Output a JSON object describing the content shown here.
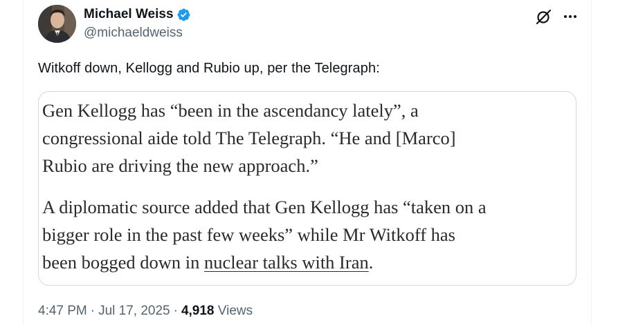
{
  "author": {
    "display_name": "Michael Weiss",
    "handle": "@michaeldweiss",
    "verified": true,
    "verified_color": "#1d9bf0"
  },
  "tweet": {
    "text": "Witkoff down, Kellogg and Rubio up, per the Telegraph:"
  },
  "quote_image": {
    "paragraph1_lines": [
      "Gen Kellogg has “been in the ascendancy lately”, a",
      "congressional aide told The Telegraph. “He and [Marco]",
      "Rubio are driving the new approach.”"
    ],
    "paragraph2_lines": [
      "A diplomatic source added that Gen Kellogg has “taken on a",
      "bigger role in the past few weeks” while Mr Witkoff has",
      "been bogged down in "
    ],
    "paragraph2_link": "nuclear talks with Iran",
    "paragraph2_end": "."
  },
  "meta": {
    "time": "4:47 PM",
    "date": "Jul 17, 2025",
    "separator": "·",
    "views_count": "4,918",
    "views_label": "Views"
  },
  "icons": {
    "grok": "grok-icon",
    "more": "more-icon",
    "verified": "verified-badge-icon"
  }
}
